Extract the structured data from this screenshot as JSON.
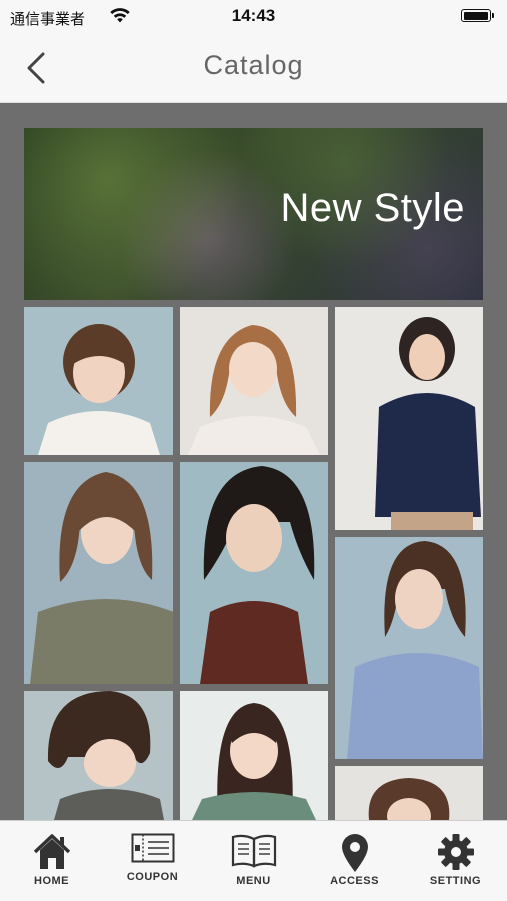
{
  "status_bar": {
    "carrier": "通信事業者",
    "time": "14:43",
    "wifi_icon": "wifi-icon",
    "battery_icon": "battery-icon"
  },
  "nav": {
    "title": "Catalog",
    "back_icon": "chevron-left-icon"
  },
  "banner": {
    "text": "New Style"
  },
  "gallery": {
    "photos": [
      {
        "name": "style-photo-1"
      },
      {
        "name": "style-photo-2"
      },
      {
        "name": "style-photo-3"
      },
      {
        "name": "style-photo-4"
      },
      {
        "name": "style-photo-5"
      },
      {
        "name": "style-photo-6"
      },
      {
        "name": "style-photo-7"
      },
      {
        "name": "style-photo-8"
      },
      {
        "name": "style-photo-9"
      }
    ]
  },
  "tabs": [
    {
      "label": "HOME",
      "icon": "home-icon"
    },
    {
      "label": "COUPON",
      "icon": "coupon-icon"
    },
    {
      "label": "MENU",
      "icon": "book-icon"
    },
    {
      "label": "ACCESS",
      "icon": "map-pin-icon"
    },
    {
      "label": "SETTING",
      "icon": "gear-icon"
    }
  ],
  "colors": {
    "background_dark": "#6e6e6e",
    "bar_background": "#f7f7f7",
    "icon_dark": "#333333"
  }
}
